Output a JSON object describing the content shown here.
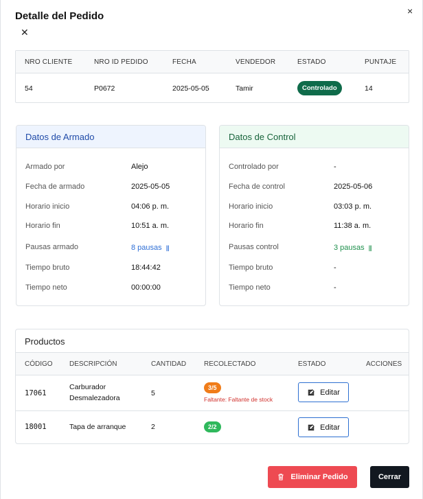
{
  "modal": {
    "title": "Detalle del Pedido",
    "close_icon_glyph": "×",
    "close_icon_glyph_2": "✕"
  },
  "summary": {
    "headers": [
      "NRO CLIENTE",
      "NRO ID PEDIDO",
      "FECHA",
      "VENDEDOR",
      "ESTADO",
      "PUNTAJE"
    ],
    "values": {
      "nro_cliente": "54",
      "nro_id_pedido": "P0672",
      "fecha": "2025-05-05",
      "vendedor": "Tamir",
      "estado": "Controlado",
      "puntaje": "14"
    }
  },
  "armado": {
    "title": "Datos de Armado",
    "rows": [
      {
        "label": "Armado por",
        "value": "Alejo"
      },
      {
        "label": "Fecha de armado",
        "value": "2025-05-05"
      },
      {
        "label": "Horario inicio",
        "value": "04:06 p. m."
      },
      {
        "label": "Horario fin",
        "value": "10:51 a. m."
      },
      {
        "label": "Pausas armado",
        "value": "8 pausas"
      },
      {
        "label": "Tiempo bruto",
        "value": "18:44:42"
      },
      {
        "label": "Tiempo neto",
        "value": "00:00:00"
      }
    ]
  },
  "control": {
    "title": "Datos de Control",
    "rows": [
      {
        "label": "Controlado por",
        "value": "-"
      },
      {
        "label": "Fecha de control",
        "value": "2025-05-06"
      },
      {
        "label": "Horario inicio",
        "value": "03:03 p. m."
      },
      {
        "label": "Horario fin",
        "value": "11:38 a. m."
      },
      {
        "label": "Pausas control",
        "value": "3 pausas"
      },
      {
        "label": "Tiempo bruto",
        "value": "-"
      },
      {
        "label": "Tiempo neto",
        "value": "-"
      }
    ]
  },
  "productos": {
    "title": "Productos",
    "headers": [
      "CÓDIGO",
      "DESCRIPCIÓN",
      "CANTIDAD",
      "RECOLECTADO",
      "ESTADO",
      "ACCIONES"
    ],
    "rows": [
      {
        "codigo": "17061",
        "descripcion_l1": "Carburador",
        "descripcion_l2": "Desmalezadora",
        "cantidad": "5",
        "recolectado": "3/5",
        "faltante": "Faltante: Faltante de stock",
        "edit_label": "Editar"
      },
      {
        "codigo": "18001",
        "descripcion_l1": "Tapa de arranque",
        "cantidad": "2",
        "recolectado": "2/2",
        "edit_label": "Editar"
      }
    ]
  },
  "footer": {
    "delete_label": "Eliminar Pedido",
    "close_label": "Cerrar"
  },
  "colors": {
    "estado_controlado": "#0f6b4a",
    "danger": "#ee4a52",
    "dark": "#121820",
    "armado_accent": "#1f4aa8",
    "control_accent": "#17643b",
    "partial": "#f07c19",
    "complete": "#2fb85c"
  },
  "icons": [
    "close-icon",
    "pause-bars-icon",
    "edit-icon",
    "trash-icon"
  ]
}
